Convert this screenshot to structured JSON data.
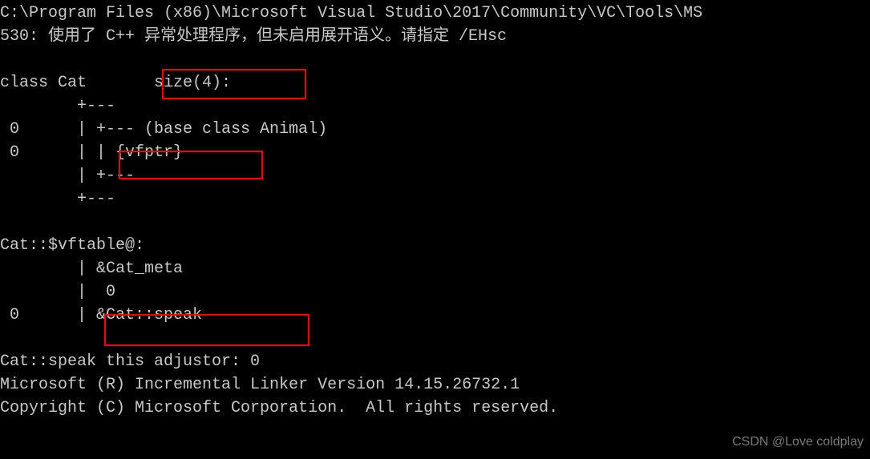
{
  "terminal": {
    "line1": "C:\\Program Files (x86)\\Microsoft Visual Studio\\2017\\Community\\VC\\Tools\\MS",
    "line2": "530: 使用了 C++ 异常处理程序，但未启用展开语义。请指定 /EHsc",
    "blank1": "",
    "classHeader_pre": "class Cat       ",
    "classHeader_size": "size(4):",
    "struct1": "        +---",
    "struct2": " 0      | +--- (base class Animal)",
    "struct3_pre": " 0      | | ",
    "struct3_vfptr": "{vfptr}",
    "struct4": "        | +---",
    "struct5": "        +---",
    "blank2": "",
    "vftable_header": "Cat::$vftable@:",
    "vftable_meta": "        | &Cat_meta",
    "vftable_zero": "        |  0",
    "vftable_entry_pre": " 0      | ",
    "vftable_entry": "&Cat::speak",
    "blank3": "",
    "adjustor": "Cat::speak this adjustor: 0",
    "linker": "Microsoft (R) Incremental Linker Version 14.15.26732.1",
    "copyright": "Copyright (C) Microsoft Corporation.  All rights reserved."
  },
  "watermark": "CSDN @Love coldplay",
  "highlights": {
    "size_label": "size(4)",
    "vfptr_label": "vfptr",
    "speak_label": "Cat::speak"
  }
}
